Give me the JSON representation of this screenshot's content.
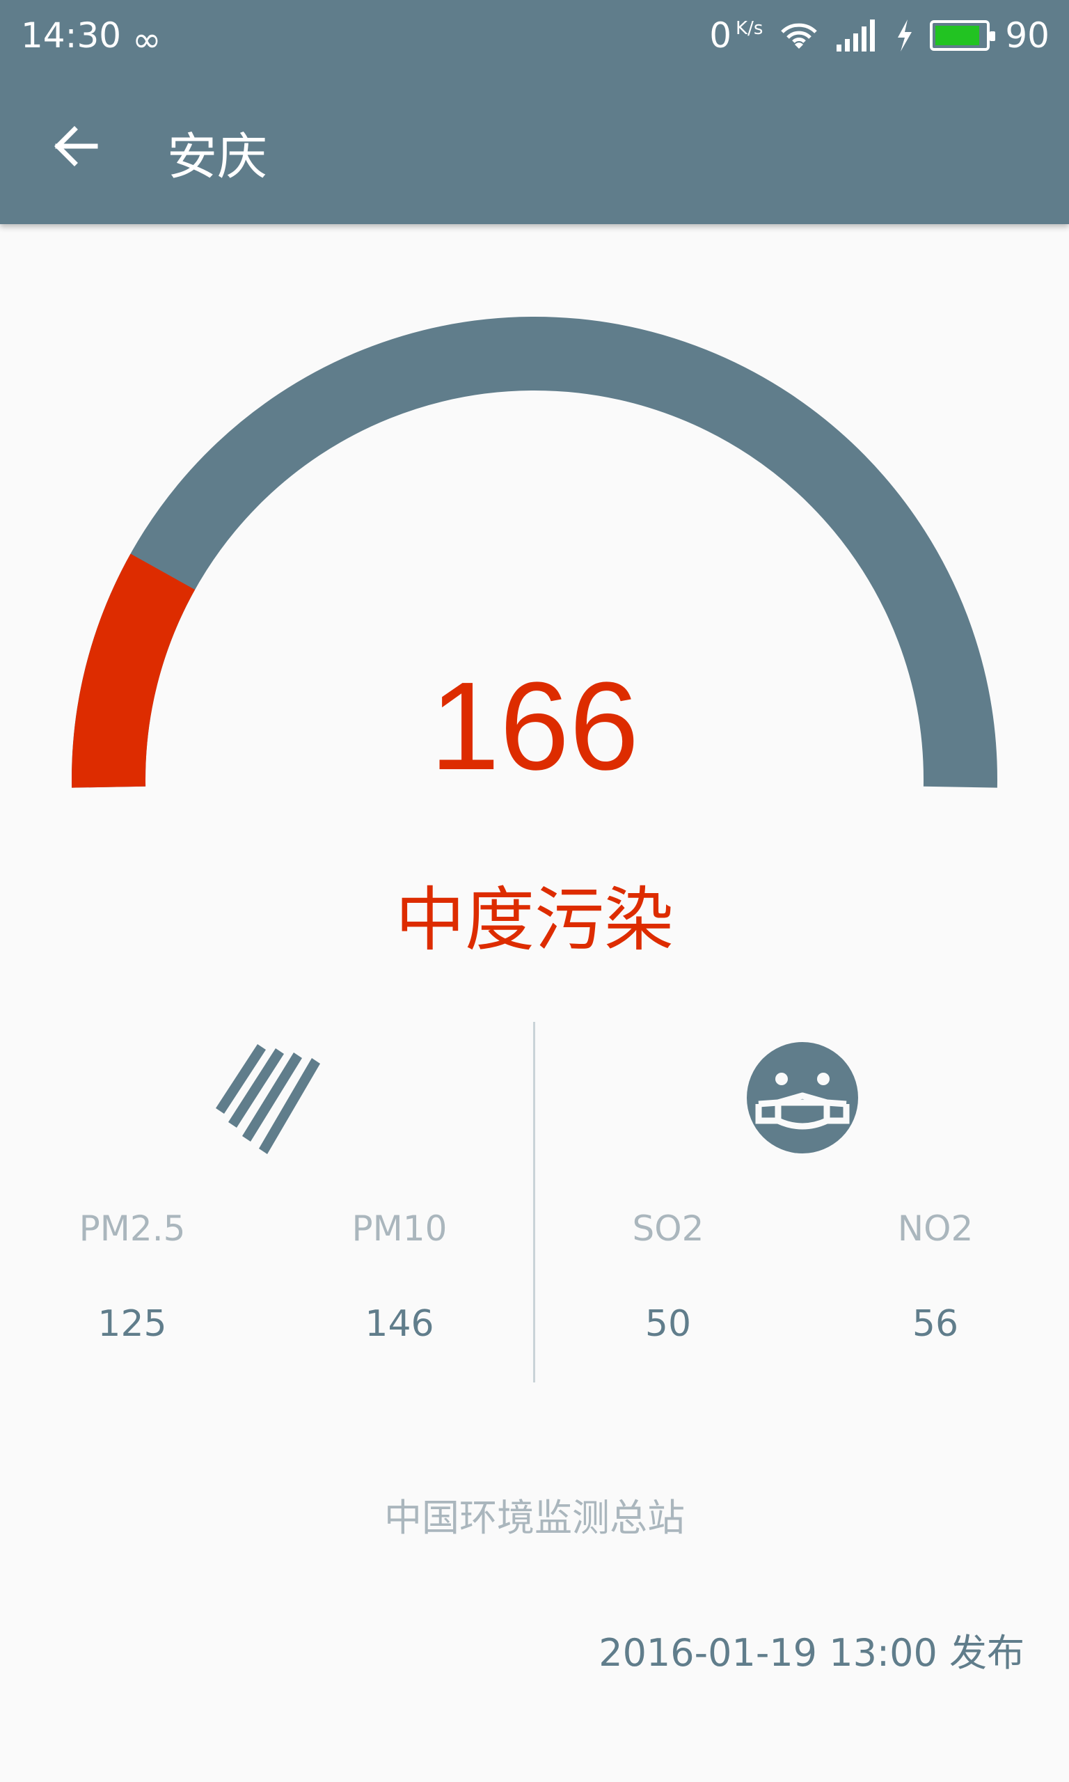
{
  "status_bar": {
    "time": "14:30",
    "infinity_icon": "∞",
    "network_speed": "0",
    "network_speed_unit": "K/s",
    "battery_level": 90,
    "battery_text": "90"
  },
  "toolbar": {
    "title": "安庆"
  },
  "aqi": {
    "value": "166",
    "level": "中度污染",
    "fraction": 0.166
  },
  "pollutants": {
    "pm25": {
      "label": "PM2.5",
      "value": "125"
    },
    "pm10": {
      "label": "PM10",
      "value": "146"
    },
    "so2": {
      "label": "SO2",
      "value": "50"
    },
    "no2": {
      "label": "NO2",
      "value": "56"
    }
  },
  "source": "中国环境监测总站",
  "publish_time": "2016-01-19 13:00 发布",
  "colors": {
    "primary": "#607d8b",
    "alert": "#dd2c00",
    "muted": "#aab6bd",
    "background": "#fafafa"
  },
  "icons": {
    "back": "arrow-left",
    "particles": "diagonal-stripes",
    "mask": "mask-face"
  }
}
